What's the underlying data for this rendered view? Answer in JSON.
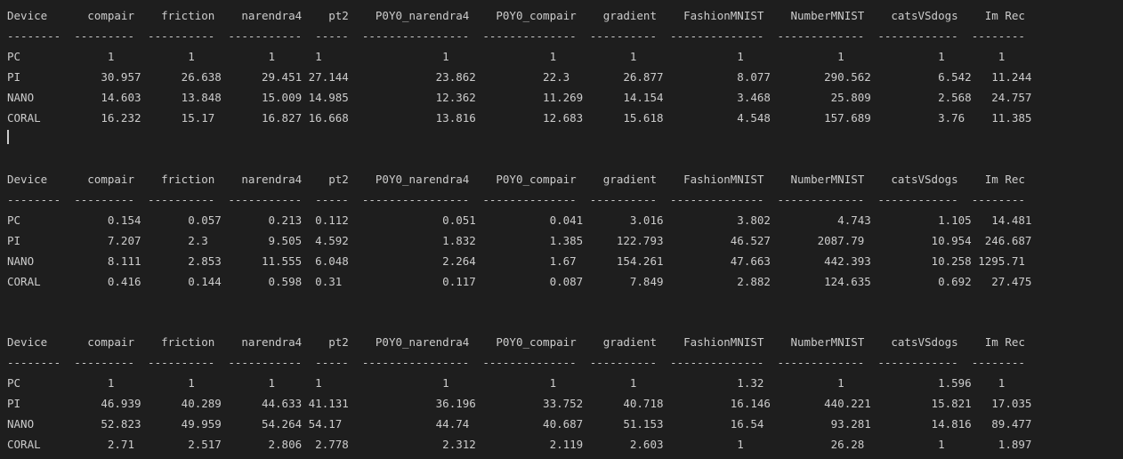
{
  "theme": {
    "background": "#1e1e1e",
    "foreground": "#cccccc"
  },
  "terminal_lines": [
    "Device      compair    friction    narendra4    pt2    P0Y0_narendra4    P0Y0_compair    gradient    FashionMNIST    NumberMNIST    catsVSdogs    Im Rec",
    "--------  ---------  ----------  -----------  -----  ----------------  --------------  ----------  --------------  -------------  ------------  --------",
    "PC             1           1           1      1                  1               1           1               1              1              1        1",
    "PI            30.957      26.638      29.451 27.144             23.862          22.3        26.877           8.077        290.562          6.542   11.244",
    "NANO          14.603      13.848      15.009 14.985             12.362          11.269      14.154           3.468         25.809          2.568   24.757",
    "CORAL         16.232      15.17       16.827 16.668             13.816          12.683      15.618           4.548        157.689          3.76    11.385",
    "",
    "Device      compair    friction    narendra4    pt2    P0Y0_narendra4    P0Y0_compair    gradient    FashionMNIST    NumberMNIST    catsVSdogs    Im Rec",
    "--------  ---------  ----------  -----------  -----  ----------------  --------------  ----------  --------------  -------------  ------------  --------",
    "PC             0.154       0.057       0.213  0.112              0.051           0.041       3.016           3.802          4.743          1.105   14.481",
    "PI             7.207       2.3         9.505  4.592              1.832           1.385     122.793          46.527       2087.79          10.954  246.687",
    "NANO           8.111       2.853      11.555  6.048              2.264           1.67      154.261          47.663        442.393         10.258 1295.71",
    "CORAL          0.416       0.144       0.598  0.31               0.117           0.087       7.849           2.882        124.635          0.692   27.475",
    "",
    "",
    "Device      compair    friction    narendra4    pt2    P0Y0_narendra4    P0Y0_compair    gradient    FashionMNIST    NumberMNIST    catsVSdogs    Im Rec",
    "--------  ---------  ----------  -----------  -----  ----------------  --------------  ----------  --------------  -------------  ------------  --------",
    "PC             1           1           1      1                  1               1           1               1.32           1              1.596    1",
    "PI            46.939      40.289      44.633 41.131             36.196          33.752      40.718          16.146        440.221         15.821   17.035",
    "NANO          52.823      49.959      54.264 54.17              44.74           40.687      51.153          16.54          93.281         14.816   89.477",
    "CORAL          2.71        2.517       2.806  2.778              2.312           2.119       2.603           1             26.28           1        1.897"
  ]
}
